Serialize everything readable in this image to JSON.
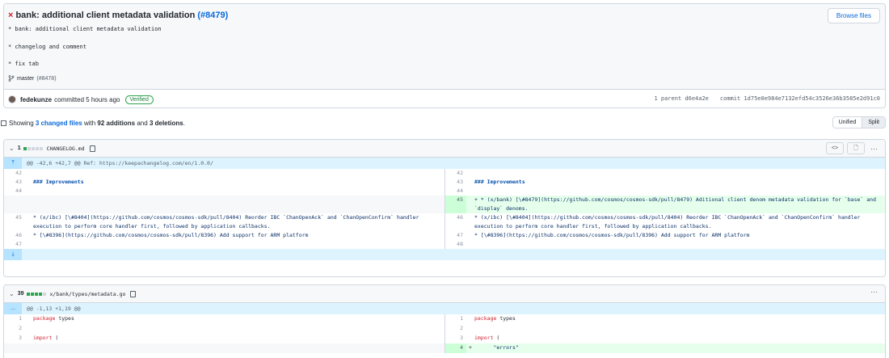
{
  "commit": {
    "status_icon": "×",
    "title": "bank: additional client metadata validation",
    "pr_ref": "(#8479)",
    "browse_label": "Browse files",
    "messages": [
      "* bank: additional client metadata validation",
      "* changelog and comment",
      "* fix tab"
    ],
    "branch": "master",
    "branch_pr": "(#8478)",
    "author": "fedekunze",
    "action": "committed 5 hours ago",
    "verified": "Verified",
    "parent_label": "1 parent",
    "parent_hash": "d6e4a2e",
    "commit_label": "commit",
    "commit_hash": "1d75e0e984e7132efd54c3526e36b3585e2d91c0"
  },
  "summary": {
    "prefix": "Showing",
    "files": "3 changed files",
    "with": "with",
    "additions": "92 additions",
    "and": "and",
    "deletions": "3 deletions",
    "unified": "Unified",
    "split": "Split"
  },
  "files": [
    {
      "count": "1",
      "name": "CHANGELOG.md",
      "hunk": "@@ -42,6 +42,7 @@ Ref: https://keepachangelog.com/en/1.0.0/",
      "left": [
        {
          "ln": "42",
          "text": ""
        },
        {
          "ln": "43",
          "text": "### Improvements"
        },
        {
          "ln": "44",
          "text": ""
        },
        {
          "ln": "",
          "text": ""
        },
        {
          "ln": "45",
          "text": "* (x/ibc) [\\#8404](https://github.com/cosmos/cosmos-sdk/pull/8404) Reorder IBC `ChanOpenAck` and `ChanOpenConfirm` handler execution to perform core handler first, followed by application callbacks."
        },
        {
          "ln": "46",
          "text": "* [\\#8396](https://github.com/cosmos/cosmos-sdk/pull/8396) Add support for ARM platform"
        },
        {
          "ln": "47",
          "text": ""
        }
      ],
      "right": [
        {
          "ln": "42",
          "text": ""
        },
        {
          "ln": "43",
          "text": "### Improvements"
        },
        {
          "ln": "44",
          "text": ""
        },
        {
          "ln": "45",
          "text": "+ * (x/bank) [\\#8479](https://github.com/cosmos/cosmos-sdk/pull/8479) Aditional client denom metadata validation for `base` and `display` denoms."
        },
        {
          "ln": "46",
          "text": "* (x/ibc) [\\#8404](https://github.com/cosmos/cosmos-sdk/pull/8404) Reorder IBC `ChanOpenAck` and `ChanOpenConfirm` handler execution to perform core handler first, followed by application callbacks."
        },
        {
          "ln": "47",
          "text": "* [\\#8396](https://github.com/cosmos/cosmos-sdk/pull/8396) Add support for ARM platform"
        },
        {
          "ln": "48",
          "text": ""
        }
      ]
    },
    {
      "count": "39",
      "name": "x/bank/types/metadata.go",
      "hunk_prefix": "...",
      "hunk": "@@ -1,13 +1,19 @@",
      "left": [
        {
          "ln": "1",
          "kw": "package",
          "text": " types"
        },
        {
          "ln": "2",
          "kw": "",
          "text": ""
        },
        {
          "ln": "3",
          "kw": "import",
          "text": " ("
        },
        {
          "ln": "",
          "kw": "",
          "text": ""
        }
      ],
      "right": [
        {
          "ln": "1",
          "kw": "package",
          "text": " types"
        },
        {
          "ln": "2",
          "kw": "",
          "text": ""
        },
        {
          "ln": "3",
          "kw": "import",
          "text": " ("
        },
        {
          "ln": "4",
          "sign": "+",
          "text": "      \"errors\""
        }
      ]
    }
  ],
  "icons": {
    "code": "<>",
    "file": "🗋",
    "kebab": "···",
    "chevron": "⌄",
    "expand_up": "⤒",
    "expand_down": "⤓"
  }
}
